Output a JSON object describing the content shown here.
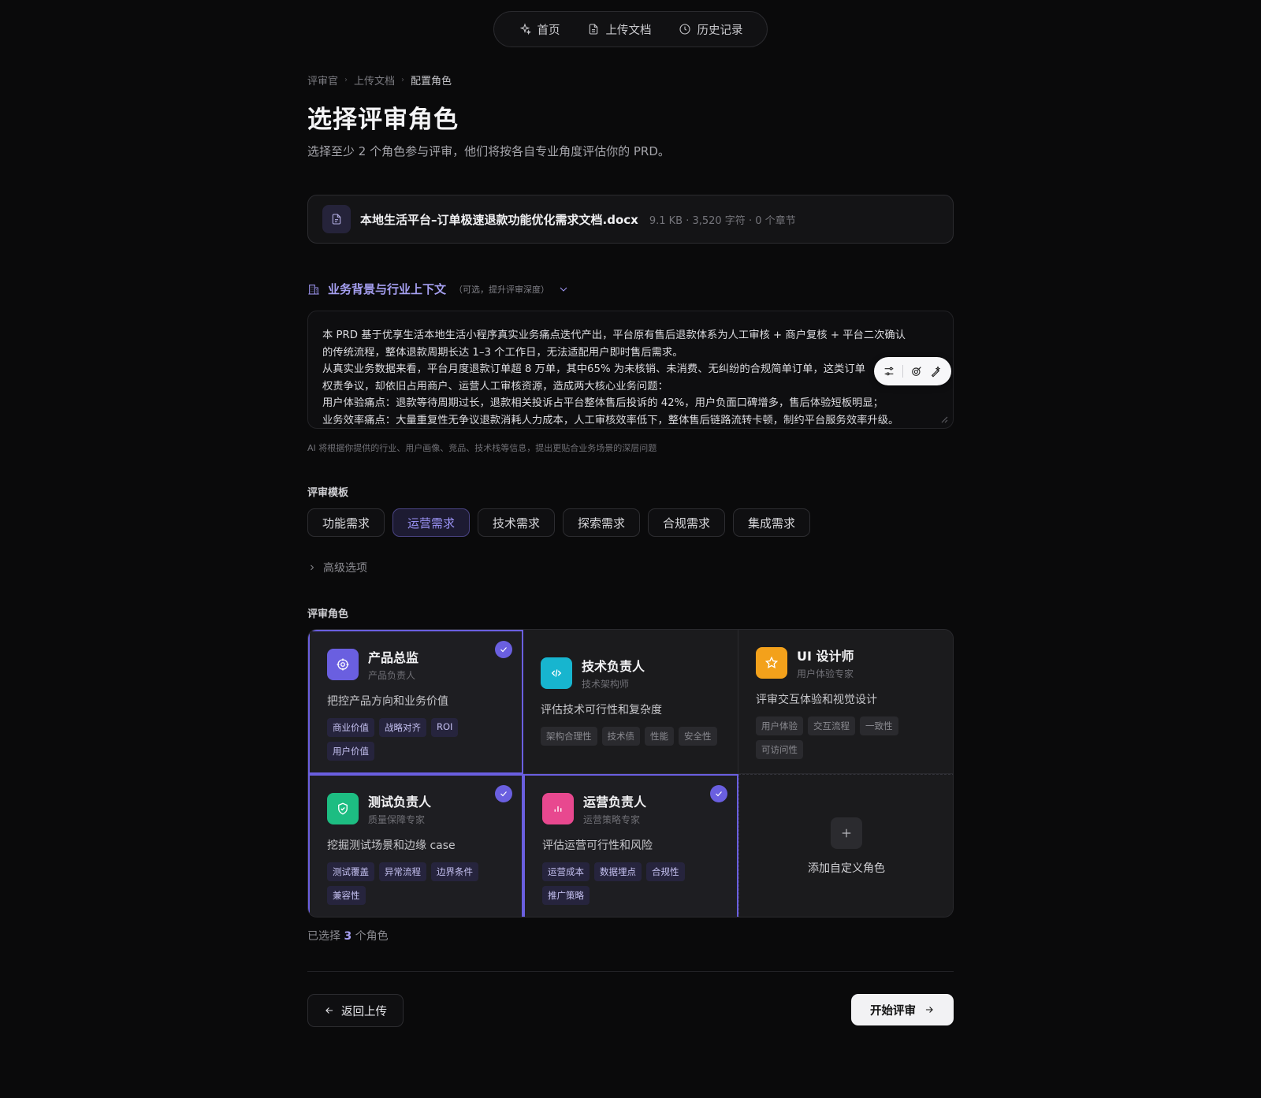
{
  "nav": {
    "items": [
      {
        "label": "首页",
        "icon": "sparkle-icon"
      },
      {
        "label": "上传文档",
        "icon": "document-icon"
      },
      {
        "label": "历史记录",
        "icon": "clock-icon"
      }
    ]
  },
  "breadcrumb": [
    "评审官",
    "上传文档",
    "配置角色"
  ],
  "page": {
    "title": "选择评审角色",
    "subtitle": "选择至少 2 个角色参与评审，他们将按各自专业角度评估你的 PRD。"
  },
  "file": {
    "name": "本地生活平台–订单极速退款功能优化需求文档.docx",
    "meta": "9.1 KB · 3,520 字符 · 0 个章节"
  },
  "context": {
    "label": "业务背景与行业上下文",
    "hint": "（可选，提升评审深度）",
    "lines": [
      "本 PRD 基于优享生活本地生活小程序真实业务痛点迭代产出，平台原有售后退款体系为人工审核 + 商户复核 + 平台二次确认",
      "的传统流程，整体退款周期长达 1–3 个工作日，无法适配用户即时售后需求。",
      "从真实业务数据来看，平台月度退款订单超 8 万单，其中65% 为未核销、未消费、无纠纷的合规简单订单，这类订单",
      "权责争议，却依旧占用商户、运营人工审核资源，造成两大核心业务问题：",
      "用户体验痛点：退款等待周期过长，退款相关投诉占平台整体售后投诉的 42%，用户负面口碑增多，售后体验短板明显；",
      "业务效率痛点：大量重复性无争议退款消耗人力成本，人工审核效率低下，整体售后链路流转卡顿，制约平台服务效率升级。"
    ],
    "note": "AI 将根据你提供的行业、用户画像、竞品、技术栈等信息，提出更贴合业务场景的深层问题"
  },
  "templates": {
    "label": "评审模板",
    "items": [
      "功能需求",
      "运营需求",
      "技术需求",
      "探索需求",
      "合规需求",
      "集成需求"
    ],
    "active": "运营需求"
  },
  "advanced": {
    "label": "高级选项"
  },
  "roles": {
    "label": "评审角色",
    "items": [
      {
        "title": "产品总监",
        "sub": "产品负责人",
        "desc": "把控产品方向和业务价值",
        "tags": [
          "商业价值",
          "战略对齐",
          "ROI",
          "用户价值"
        ],
        "selected": true,
        "color": "#6a5fe0",
        "icon": "target-icon"
      },
      {
        "title": "技术负责人",
        "sub": "技术架构师",
        "desc": "评估技术可行性和复杂度",
        "tags": [
          "架构合理性",
          "技术债",
          "性能",
          "安全性"
        ],
        "selected": false,
        "color": "#17b5cf",
        "icon": "code-icon"
      },
      {
        "title": "UI 设计师",
        "sub": "用户体验专家",
        "desc": "评审交互体验和视觉设计",
        "tags": [
          "用户体验",
          "交互流程",
          "一致性",
          "可访问性"
        ],
        "selected": false,
        "color": "#f3a11b",
        "icon": "star-icon"
      },
      {
        "title": "测试负责人",
        "sub": "质量保障专家",
        "desc": "挖掘测试场景和边缘 case",
        "tags": [
          "测试覆盖",
          "异常流程",
          "边界条件",
          "兼容性"
        ],
        "selected": true,
        "color": "#1dbd82",
        "icon": "shield-icon"
      },
      {
        "title": "运营负责人",
        "sub": "运营策略专家",
        "desc": "评估运营可行性和风险",
        "tags": [
          "运营成本",
          "数据埋点",
          "合规性",
          "推广策略"
        ],
        "selected": true,
        "color": "#e8488f",
        "icon": "bar-chart-icon"
      }
    ],
    "add_label": "添加自定义角色"
  },
  "summary": {
    "prefix": "已选择",
    "count": "3",
    "suffix": "个角色"
  },
  "actions": {
    "back": "返回上传",
    "start": "开始评审"
  }
}
